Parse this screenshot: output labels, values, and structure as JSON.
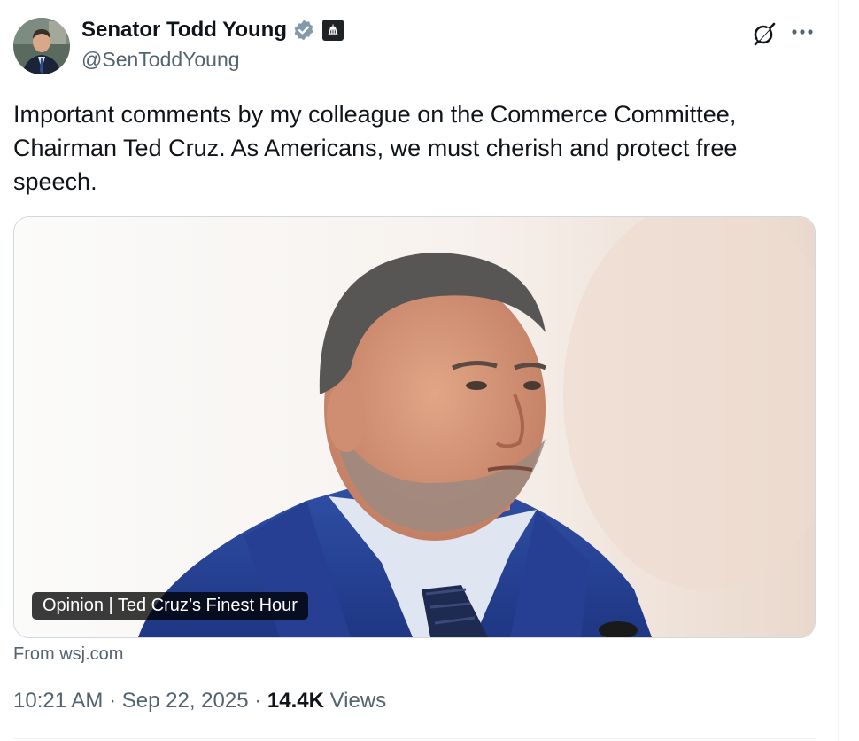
{
  "author": {
    "display_name": "Senator Todd Young",
    "handle": "@SenToddYoung"
  },
  "tweet": {
    "text": "Important comments by my colleague on the Commerce Committee, Chairman Ted Cruz. As Americans, we must cherish and protect free speech."
  },
  "card": {
    "title": "Opinion | Ted Cruz’s Finest Hour",
    "source": "From wsj.com"
  },
  "meta": {
    "time": "10:21 AM",
    "separator": "·",
    "date": "Sep 22, 2025",
    "views_count": "14.4K",
    "views_label": "Views"
  },
  "icons": {
    "verified": "verified-badge-icon",
    "affiliation": "capitol-building-icon",
    "grok": "grok-icon",
    "more": "more-dots-icon"
  },
  "colors": {
    "primary_text": "#0f1419",
    "secondary_text": "#536471",
    "verified_badge": "#829aab",
    "border": "#cfd9de"
  }
}
